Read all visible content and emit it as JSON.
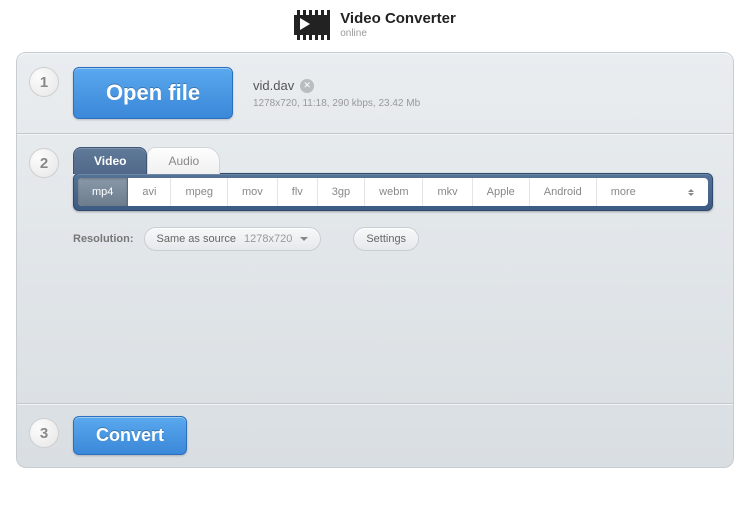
{
  "app": {
    "title": "Video Converter",
    "subtitle": "online"
  },
  "steps": {
    "one": "1",
    "two": "2",
    "three": "3"
  },
  "open_button": "Open file",
  "file": {
    "name": "vid.dav",
    "details": "1278x720, 11:18, 290 kbps, 23.42 Mb"
  },
  "tabs": {
    "video": "Video",
    "audio": "Audio"
  },
  "formats": {
    "mp4": "mp4",
    "avi": "avi",
    "mpeg": "mpeg",
    "mov": "mov",
    "flv": "flv",
    "3gp": "3gp",
    "webm": "webm",
    "mkv": "mkv",
    "apple": "Apple",
    "android": "Android",
    "more": "more"
  },
  "resolution": {
    "label": "Resolution:",
    "mode": "Same as source",
    "value": "1278x720"
  },
  "settings_button": "Settings",
  "convert_button": "Convert"
}
